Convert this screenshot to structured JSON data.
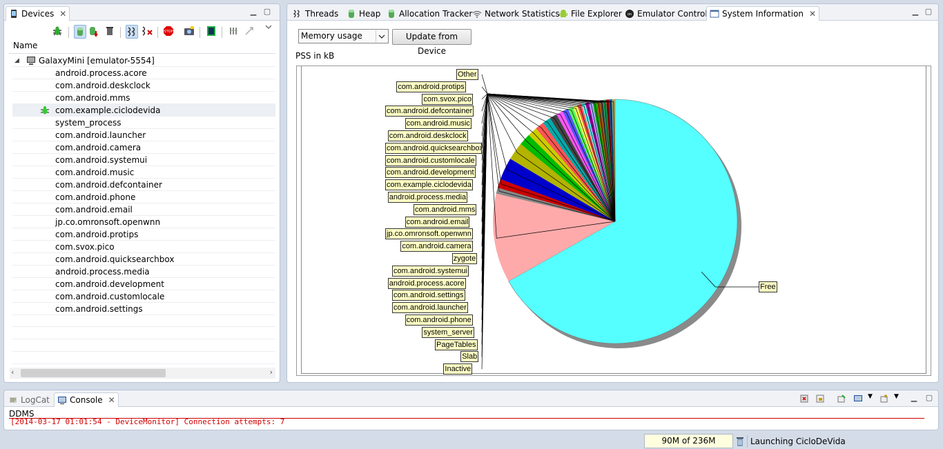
{
  "devices_panel": {
    "tab_label": "Devices",
    "column_name": "Name",
    "device": "GalaxyMini [emulator-5554]",
    "processes": [
      "android.process.acore",
      "com.android.deskclock",
      "com.android.mms",
      "com.example.ciclodevida",
      "system_process",
      "com.android.launcher",
      "com.android.camera",
      "com.android.systemui",
      "com.android.music",
      "com.android.defcontainer",
      "com.android.phone",
      "com.android.email",
      "jp.co.omronsoft.openwnn",
      "com.android.protips",
      "com.svox.pico",
      "com.android.quicksearchbox",
      "android.process.media",
      "com.android.development",
      "com.android.customlocale",
      "com.android.settings"
    ],
    "debug_process_index": 3
  },
  "main_tabs": [
    {
      "label": "Threads",
      "icon": "threads-icon"
    },
    {
      "label": "Heap",
      "icon": "heap-icon"
    },
    {
      "label": "Allocation Tracker",
      "icon": "allocation-icon"
    },
    {
      "label": "Network Statistics",
      "icon": "network-icon"
    },
    {
      "label": "File Explorer",
      "icon": "android-icon"
    },
    {
      "label": "Emulator Control",
      "icon": "emulator-icon"
    },
    {
      "label": "System Information",
      "icon": "sysinfo-icon",
      "active": true
    }
  ],
  "system_info": {
    "select_value": "Memory usage",
    "update_button": "Update from Device",
    "pss_label": "PSS in kB"
  },
  "chart_data": {
    "type": "pie",
    "title": "",
    "series": [
      {
        "label": "Free",
        "value": 68.0,
        "color": "#55ffff"
      },
      {
        "label": "Inactive",
        "value": 12.0,
        "color": "#ffaaaa"
      },
      {
        "label": "Slab",
        "value": 0.8,
        "color": "#888888"
      },
      {
        "label": "PageTables",
        "value": 1.2,
        "color": "#cc0000"
      },
      {
        "label": "system_server",
        "value": 3.0,
        "color": "#0000cc"
      },
      {
        "label": "com.android.phone",
        "value": 2.4,
        "color": "#b3b300"
      },
      {
        "label": "com.android.launcher",
        "value": 1.6,
        "color": "#00bb00"
      },
      {
        "label": "com.android.settings",
        "value": 1.3,
        "color": "#cccc00"
      },
      {
        "label": "android.process.acore",
        "value": 1.2,
        "color": "#ff5555"
      },
      {
        "label": "com.android.systemui",
        "value": 1.1,
        "color": "#00aaaa"
      },
      {
        "label": "zygote",
        "value": 1.0,
        "color": "#444444"
      },
      {
        "label": "com.android.camera",
        "value": 0.9,
        "color": "#ff55ff"
      },
      {
        "label": "jp.co.omronsoft.openwnn",
        "value": 0.8,
        "color": "#5555ff"
      },
      {
        "label": "com.android.email",
        "value": 0.7,
        "color": "#55ff55"
      },
      {
        "label": "com.android.mms",
        "value": 0.6,
        "color": "#ffff55"
      },
      {
        "label": "android.process.media",
        "value": 0.6,
        "color": "#ff5555"
      },
      {
        "label": "com.example.ciclodevida",
        "value": 0.5,
        "color": "#55ffff"
      },
      {
        "label": "com.android.development",
        "value": 0.5,
        "color": "#aa00aa"
      },
      {
        "label": "com.android.customlocale",
        "value": 0.5,
        "color": "#aaaaff"
      },
      {
        "label": "com.android.quicksearchbox",
        "value": 0.5,
        "color": "#00aa00"
      },
      {
        "label": "com.android.deskclock",
        "value": 0.5,
        "color": "#aa5500"
      },
      {
        "label": "com.android.music",
        "value": 0.4,
        "color": "#555555"
      },
      {
        "label": "com.android.defcontainer",
        "value": 0.4,
        "color": "#00aa55"
      },
      {
        "label": "com.svox.pico",
        "value": 0.4,
        "color": "#aa0000"
      },
      {
        "label": "com.android.protips",
        "value": 0.4,
        "color": "#0055aa"
      },
      {
        "label": "Other",
        "value": 0.4,
        "color": "#aaaa55"
      }
    ]
  },
  "bottom_panel": {
    "tabs": [
      "LogCat",
      "Console"
    ],
    "active_tab": "Console",
    "console_title": "DDMS",
    "console_line": "[2014-03-17 01:01:54 - DeviceMonitor] Connection attempts: 7"
  },
  "status_bar": {
    "memory": "90M of 236M",
    "message": "Launching CicloDeVida"
  }
}
